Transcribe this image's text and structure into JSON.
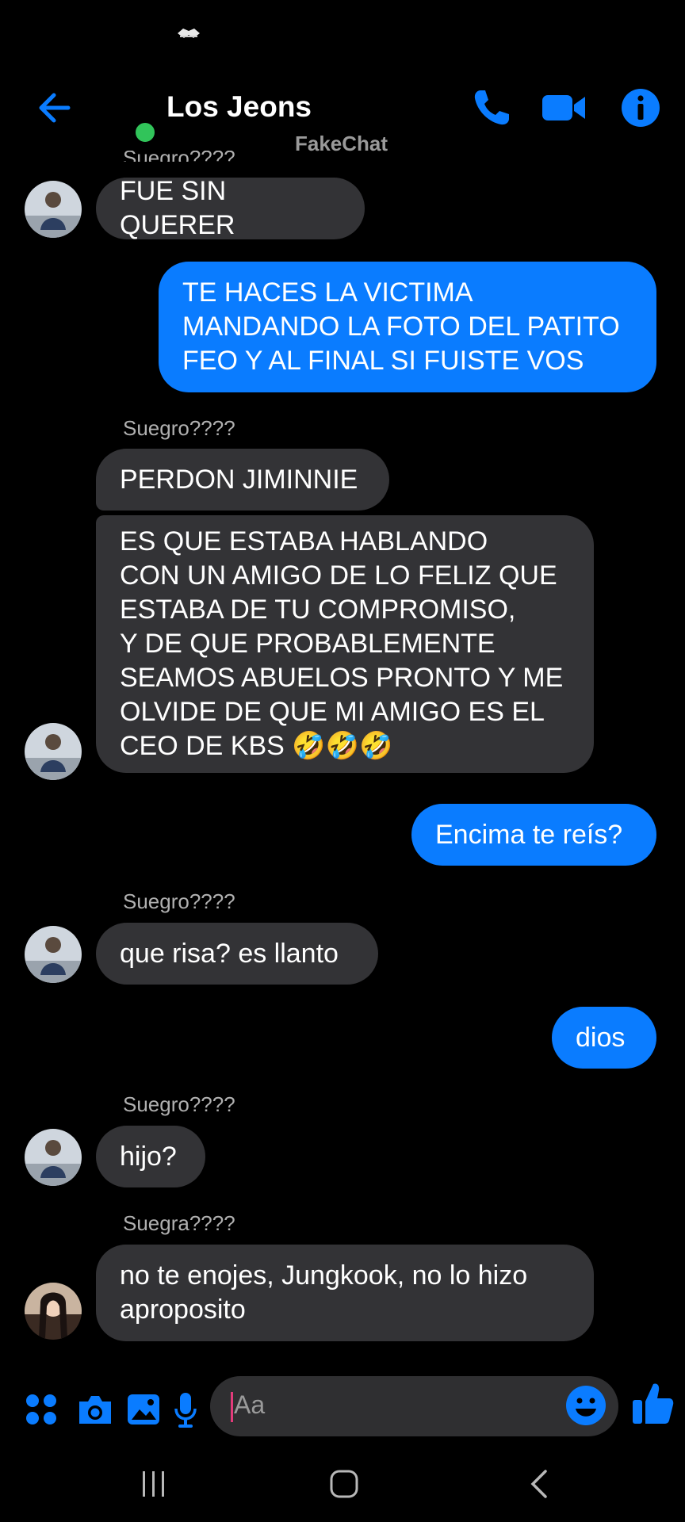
{
  "header": {
    "title": "Los Jeons",
    "watermark": "FakeChat"
  },
  "colors": {
    "accent": "#0a7cff",
    "incoming_bubble": "#333336",
    "online": "#31c45a"
  },
  "messages": {
    "m0": {
      "text": "FUE SIN QUERER"
    },
    "m1": {
      "text": "TE HACES LA VICTIMA\nMANDANDO LA FOTO DEL PATITO\nFEO Y AL FINAL SI FUISTE VOS"
    },
    "s2": "Suegro????",
    "m2": {
      "text": "PERDON JIMINNIE"
    },
    "m3": {
      "text": "ES QUE ESTABA HABLANDO\nCON UN AMIGO DE LO FELIZ QUE\nESTABA DE TU COMPROMISO,\nY DE QUE PROBABLEMENTE\nSEAMOS ABUELOS PRONTO Y ME\nOLVIDE DE QUE MI AMIGO ES EL\nCEO DE KBS 🤣🤣🤣"
    },
    "m4": {
      "text": "Encima te reís?"
    },
    "s5": "Suegro????",
    "m5": {
      "text": "que risa? es llanto"
    },
    "m6": {
      "text": "dios"
    },
    "s7": "Suegro????",
    "m7": {
      "text": "hijo?"
    },
    "s8": "Suegra????",
    "m8": {
      "text": "no te enojes, Jungkook, no lo hizo\naproposito"
    }
  },
  "composer": {
    "placeholder": "Aa",
    "icons": [
      "apps-icon",
      "camera-icon",
      "gallery-icon",
      "mic-icon",
      "emoji-icon",
      "thumbs-up-icon"
    ]
  },
  "navbar": {
    "icons": [
      "recent-apps-icon",
      "home-icon",
      "back-nav-icon"
    ]
  }
}
